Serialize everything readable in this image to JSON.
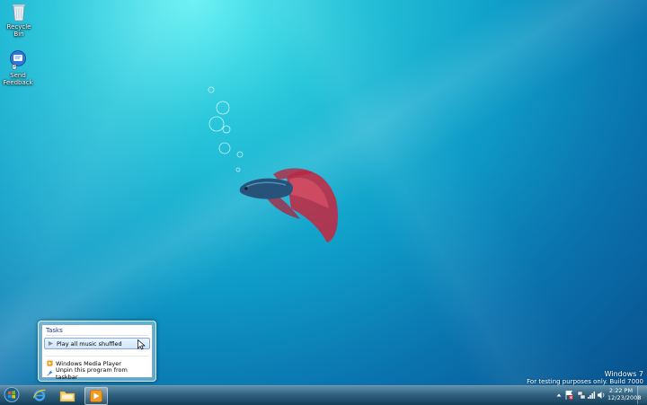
{
  "desktop": {
    "icons": [
      {
        "label": "Recycle Bin",
        "icon": "recycle-bin-icon"
      },
      {
        "label": "Send Feedback",
        "icon": "send-feedback-icon"
      }
    ],
    "wallpaper": "betta-fish-wallpaper"
  },
  "watermark": {
    "brand": "Windows 7",
    "line": "For testing purposes only. Build 7000"
  },
  "jumplist": {
    "category": "Tasks",
    "tasks": [
      {
        "label": "Play all music shuffled",
        "icon": "play-icon",
        "highlighted": true
      }
    ],
    "footer": [
      {
        "label": "Windows Media Player",
        "icon": "media-player-icon"
      },
      {
        "label": "Unpin this program from taskbar",
        "icon": "unpin-icon"
      }
    ]
  },
  "taskbar": {
    "start": "windows-orb-icon",
    "pinned": [
      {
        "name": "Internet Explorer",
        "icon": "internet-explorer-icon"
      },
      {
        "name": "Windows Explorer",
        "icon": "folder-icon"
      },
      {
        "name": "Windows Media Player",
        "icon": "media-player-icon",
        "active": true
      }
    ],
    "tray_icons": [
      "show-hidden-icons",
      "action-center-icon",
      "network-icon",
      "signal-icon",
      "volume-icon"
    ],
    "clock": {
      "time": "2:22 PM",
      "date": "12/23/2008"
    }
  },
  "colors": {
    "taskbar_top": "#5f8fa9",
    "taskbar_bottom": "#143e5a",
    "jumplist_category": "#1e3287",
    "highlight_border": "#84acdd"
  }
}
